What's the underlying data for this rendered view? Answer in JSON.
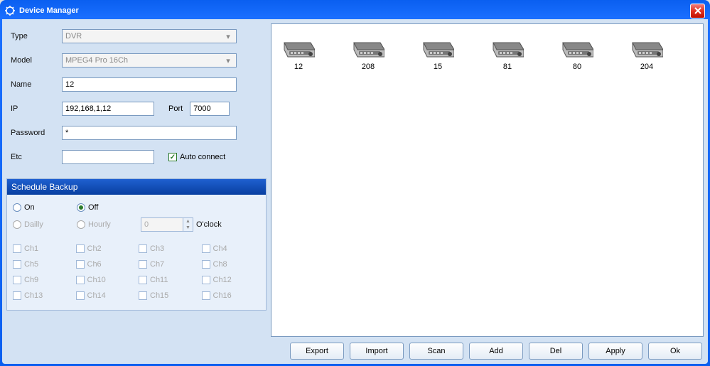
{
  "window": {
    "title": "Device Manager"
  },
  "form": {
    "labels": {
      "type": "Type",
      "model": "Model",
      "name": "Name",
      "ip": "IP",
      "port": "Port",
      "password": "Password",
      "etc": "Etc"
    },
    "values": {
      "type": "DVR",
      "model": "MPEG4 Pro 16Ch",
      "name": "12",
      "ip": "192,168,1,12",
      "port": "7000",
      "password": "*",
      "etc": ""
    },
    "auto_connect_label": "Auto connect",
    "auto_connect_checked": true
  },
  "schedule": {
    "title": "Schedule Backup",
    "on_label": "On",
    "off_label": "Off",
    "daily_label": "Dailly",
    "hourly_label": "Hourly",
    "selected": "off",
    "hour_value": "0",
    "oclock_label": "O'clock",
    "channels": [
      "Ch1",
      "Ch2",
      "Ch3",
      "Ch4",
      "Ch5",
      "Ch6",
      "Ch7",
      "Ch8",
      "Ch9",
      "Ch10",
      "Ch11",
      "Ch12",
      "Ch13",
      "Ch14",
      "Ch15",
      "Ch16"
    ]
  },
  "devices": [
    {
      "label": "12"
    },
    {
      "label": "208"
    },
    {
      "label": "15"
    },
    {
      "label": "81"
    },
    {
      "label": "80"
    },
    {
      "label": "204"
    }
  ],
  "buttons": {
    "export": "Export",
    "import": "Import",
    "scan": "Scan",
    "add": "Add",
    "del": "Del",
    "apply": "Apply",
    "ok": "Ok"
  }
}
